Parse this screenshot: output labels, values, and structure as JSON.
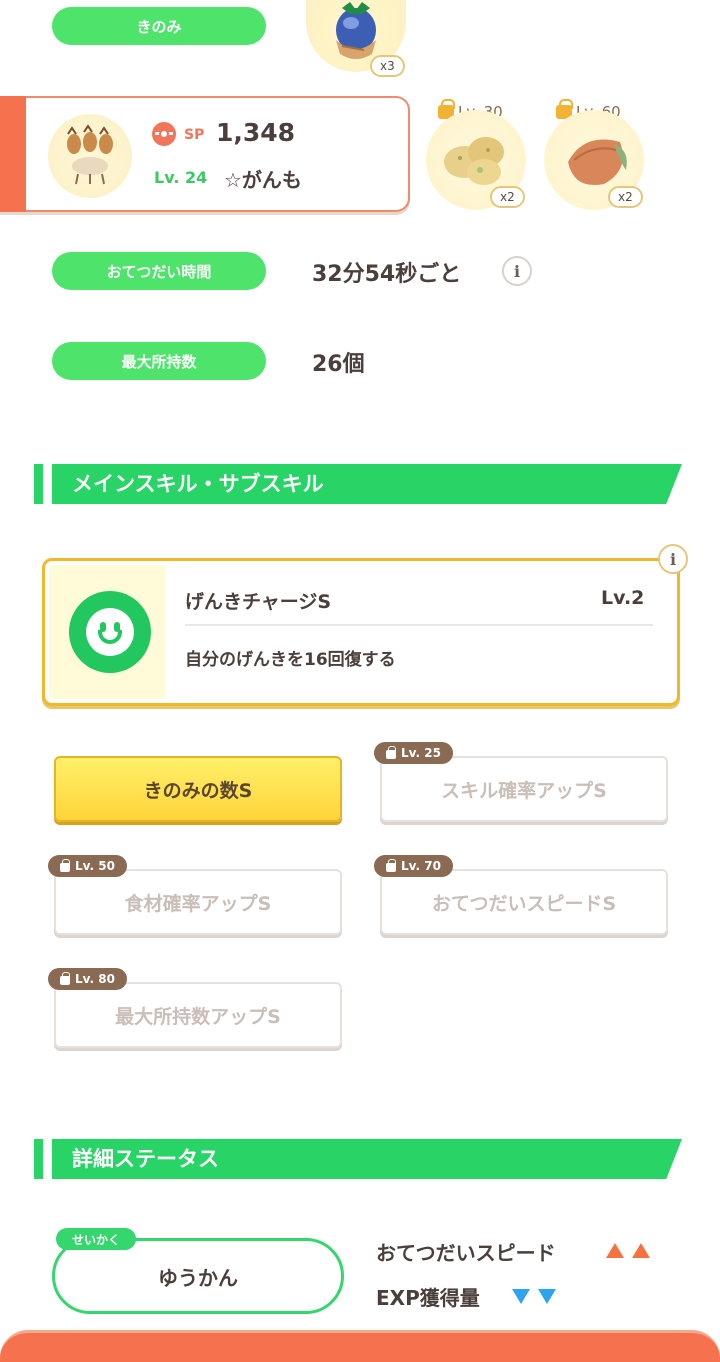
{
  "berry": {
    "label": "きのみ",
    "count": "x3",
    "icon": "blueberry-icon"
  },
  "pokemon": {
    "sp_label": "SP",
    "sp_value": "1,348",
    "level": "Lv. 24",
    "nickname": "☆がんも",
    "icon": "pokemon-portrait-icon"
  },
  "ingredients": [
    {
      "level": "Lv. 30",
      "count": "x2",
      "icon": "potato-icon"
    },
    {
      "level": "Lv. 60",
      "count": "x2",
      "icon": "cacao-icon"
    }
  ],
  "help_time": {
    "label": "おてつだい時間",
    "value": "32分54秒ごと"
  },
  "max_carry": {
    "label": "最大所持数",
    "value": "26個"
  },
  "skills_section": {
    "title": "メインスキル・サブスキル"
  },
  "main_skill": {
    "name": "げんきチャージS",
    "level": "Lv.2",
    "description": "自分のげんきを16回復する",
    "icon": "smile-icon"
  },
  "sub_skills": [
    {
      "label": "きのみの数S",
      "unlock": "",
      "active": true
    },
    {
      "label": "スキル確率アップS",
      "unlock": "Lv. 25",
      "active": false
    },
    {
      "label": "食材確率アップS",
      "unlock": "Lv. 50",
      "active": false
    },
    {
      "label": "おてつだいスピードS",
      "unlock": "Lv. 70",
      "active": false
    },
    {
      "label": "最大所持数アップS",
      "unlock": "Lv. 80",
      "active": false
    }
  ],
  "details_section": {
    "title": "詳細ステータス"
  },
  "nature": {
    "tag": "せいかく",
    "value": "ゆうかん",
    "up_label": "おてつだいスピード",
    "down_label": "EXP獲得量"
  },
  "colors": {
    "accent_green": "#27d465",
    "accent_orange": "#f6724f",
    "gold": "#f0b82b"
  }
}
